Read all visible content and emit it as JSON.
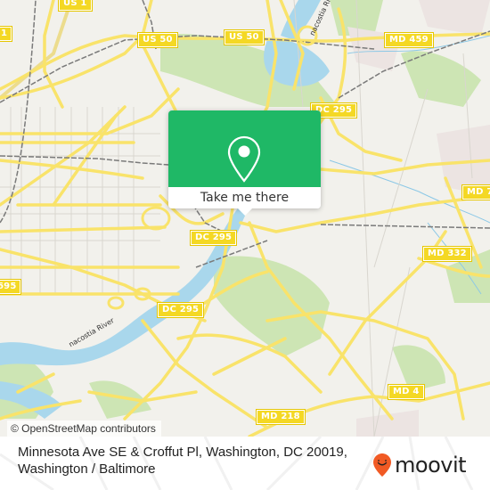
{
  "map": {
    "road_shields": [
      {
        "id": "us1",
        "label": "US 1"
      },
      {
        "id": "us1-left",
        "label": "1"
      },
      {
        "id": "us50-a",
        "label": "US 50"
      },
      {
        "id": "us50-b",
        "label": "US 50"
      },
      {
        "id": "md459",
        "label": "MD 459"
      },
      {
        "id": "dc295-a",
        "label": "DC 295"
      },
      {
        "id": "dc295-b",
        "label": "DC 295"
      },
      {
        "id": "dc295-c",
        "label": "DC 295"
      },
      {
        "id": "md7",
        "label": "MD 7"
      },
      {
        "id": "md332",
        "label": "MD 332"
      },
      {
        "id": "i695",
        "label": "695"
      },
      {
        "id": "md4",
        "label": "MD 4"
      },
      {
        "id": "md218",
        "label": "MD 218"
      }
    ],
    "river_labels": [
      {
        "id": "anacostia-top",
        "label": "nacostia Ri"
      },
      {
        "id": "anacostia-bottom",
        "label": "nacostia River"
      }
    ],
    "attribution": "© OpenStreetMap contributors",
    "colors": {
      "land": "#f2f1ec",
      "park": "#cde5b4",
      "water": "#a9d7ec",
      "road": "#f9e36a",
      "rail": "#7a7a7a"
    }
  },
  "popup": {
    "action_label": "Take me there",
    "icon": "map-pin-icon",
    "accent_color": "#1fb866"
  },
  "footer": {
    "address": "Minnesota Ave SE & Croffut Pl, Washington, DC 20019, Washington / Baltimore",
    "brand": "moovit",
    "brand_icon": "moovit-pin-logo-icon",
    "brand_color": "#f15a24"
  }
}
